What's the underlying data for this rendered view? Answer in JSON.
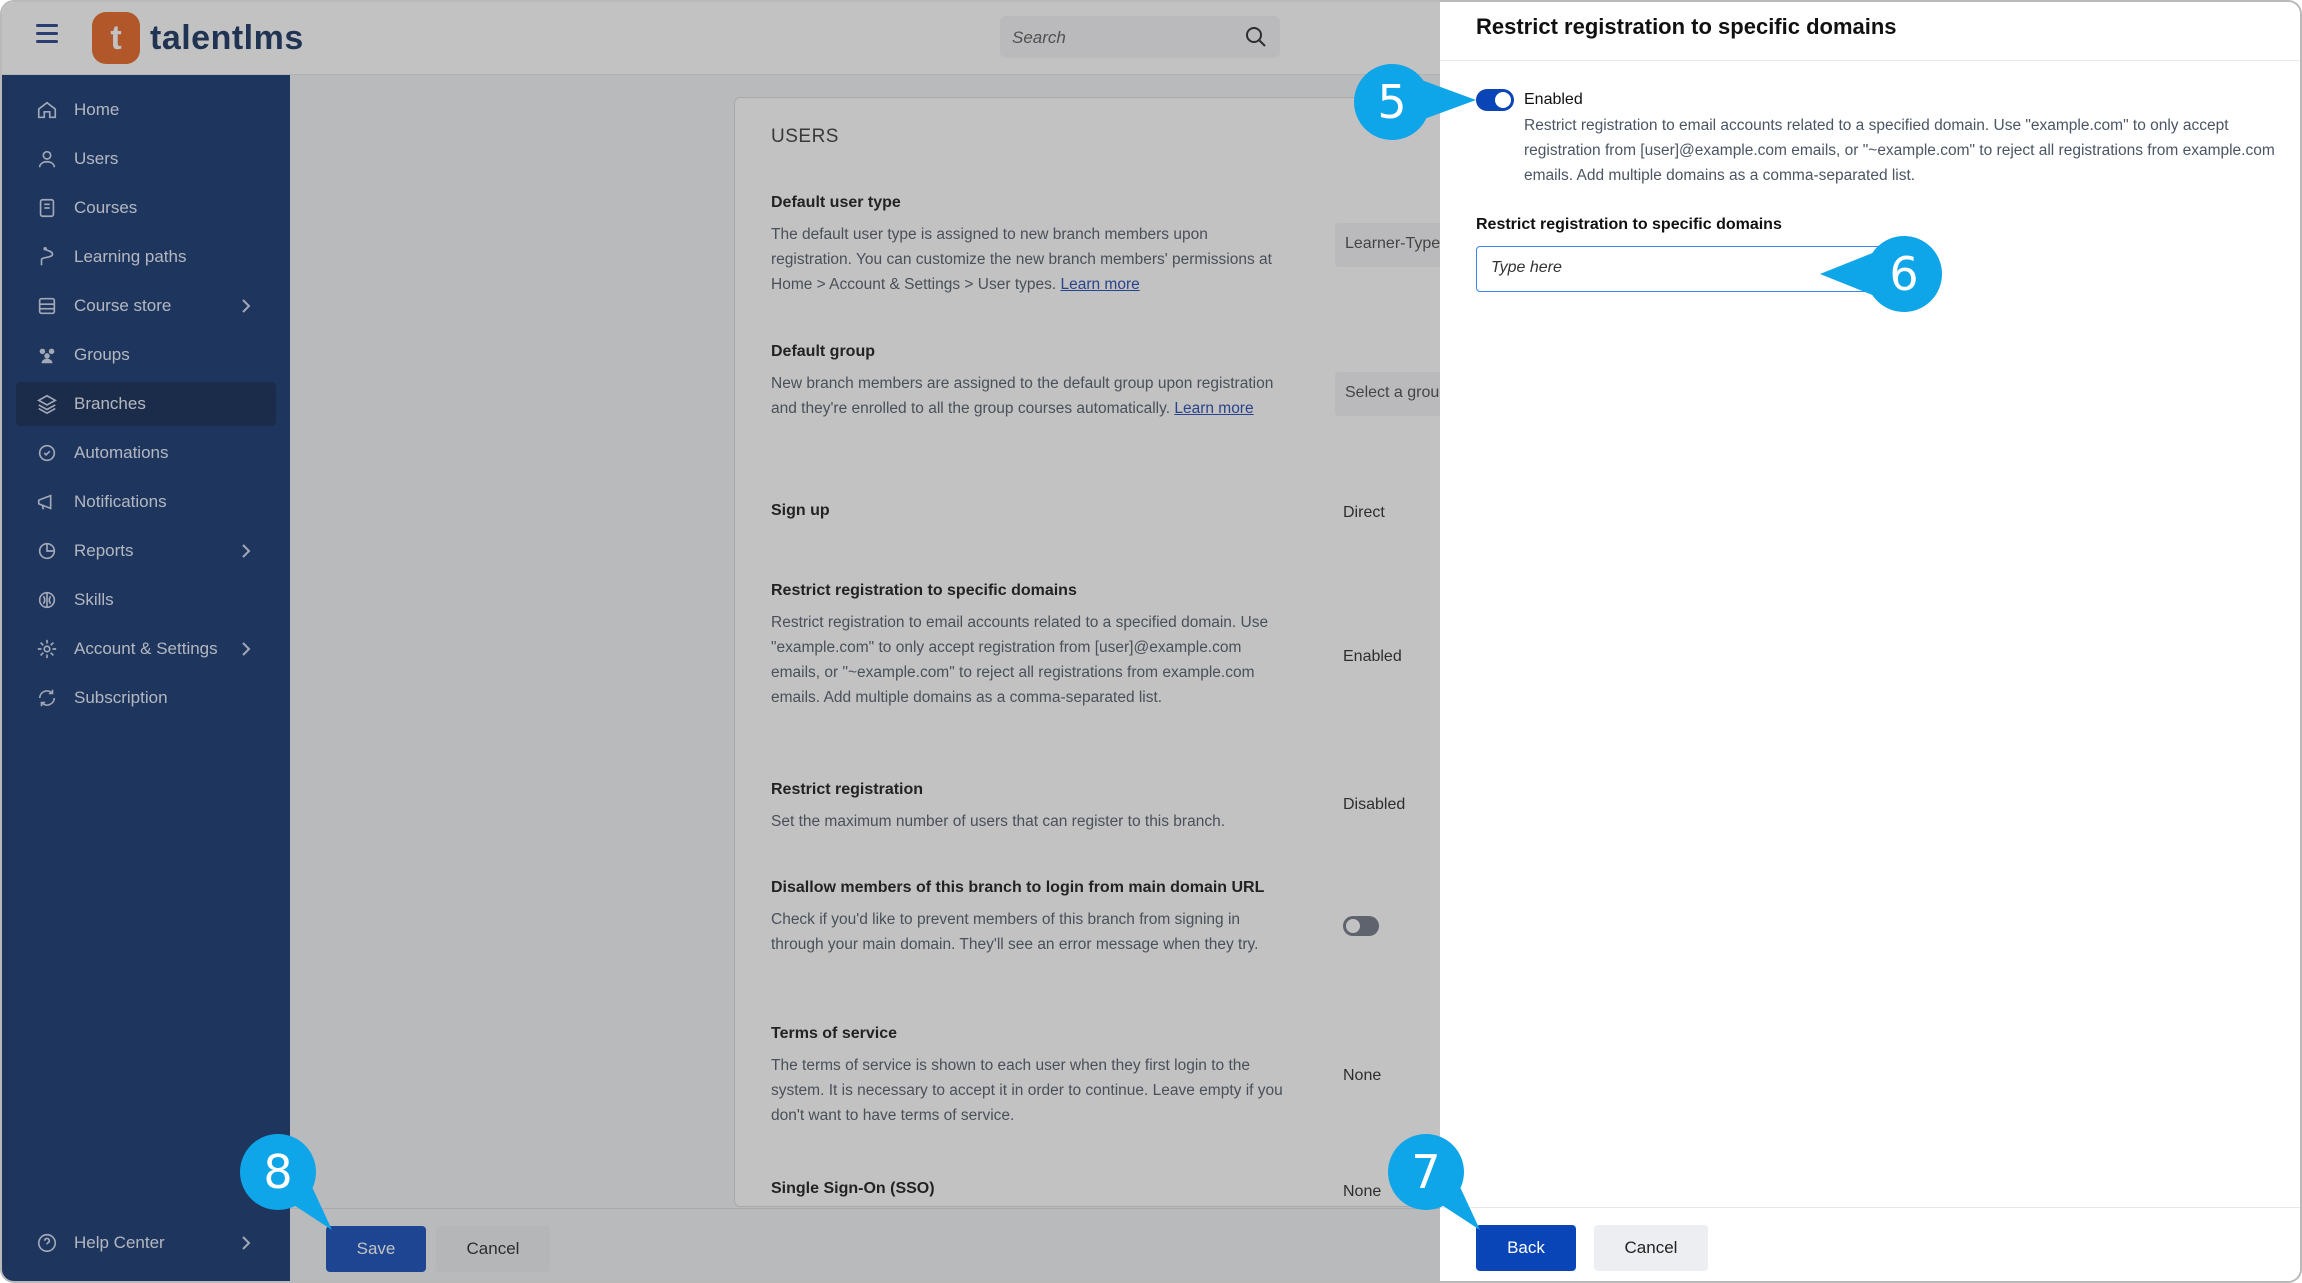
{
  "app": {
    "logo_letter": "t",
    "logo_text": "talentlms"
  },
  "search": {
    "placeholder": "Search"
  },
  "sidebar": {
    "items": [
      {
        "label": "Home"
      },
      {
        "label": "Users"
      },
      {
        "label": "Courses"
      },
      {
        "label": "Learning paths"
      },
      {
        "label": "Course store"
      },
      {
        "label": "Groups"
      },
      {
        "label": "Branches"
      },
      {
        "label": "Automations"
      },
      {
        "label": "Notifications"
      },
      {
        "label": "Reports"
      },
      {
        "label": "Skills"
      },
      {
        "label": "Account & Settings"
      },
      {
        "label": "Subscription"
      }
    ],
    "active": "Branches",
    "help": "Help Center"
  },
  "main": {
    "section_title": "USERS",
    "settings": [
      {
        "title": "Default user type",
        "desc": "The default user type is assigned to new branch members upon registration. You can customize the new branch members' permissions at Home > Account & Settings > User types.",
        "link": "Learn more",
        "value": "Learner-Type"
      },
      {
        "title": "Default group",
        "desc": "New branch members are assigned to the default group upon registration and they're enrolled to all the group courses automatically.",
        "link": "Learn more",
        "value": "Select a group"
      },
      {
        "title": "Sign up",
        "value": "Direct"
      },
      {
        "title": "Restrict registration to specific domains",
        "desc": "Restrict registration to email accounts related to a specified domain. Use \"example.com\" to only accept registration from [user]@example.com emails, or \"~example.com\" to reject all registrations from example.com emails. Add multiple domains as a comma-separated list.",
        "value": "Enabled"
      },
      {
        "title": "Restrict registration",
        "desc": "Set the maximum number of users that can register to this branch.",
        "value": "Disabled"
      },
      {
        "title": "Disallow members of this branch to login from main domain URL",
        "desc": "Check if you'd like to prevent members of this branch from signing in through your main domain. They'll see an error message when they try."
      },
      {
        "title": "Terms of service",
        "desc": "The terms of service is shown to each user when they first login to the system. It is necessary to accept it in order to continue. Leave empty if you don't want to have terms of service.",
        "value": "None"
      },
      {
        "title": "Single Sign-On (SSO)",
        "value": "None"
      }
    ],
    "save_label": "Save",
    "cancel_label": "Cancel"
  },
  "drawer": {
    "title": "Restrict registration to specific domains",
    "toggle_label": "Enabled",
    "desc": "Restrict registration to email accounts related to a specified domain. Use \"example.com\" to only accept registration from [user]@example.com emails, or \"~example.com\" to reject all registrations from example.com emails. Add multiple domains as a comma-separated list.",
    "field_label": "Restrict registration to specific domains",
    "field_placeholder": "Type here",
    "back_label": "Back",
    "cancel_label": "Cancel"
  },
  "callouts": [
    "5",
    "6",
    "7",
    "8"
  ],
  "colors": {
    "sidebar": "#0b2d6b",
    "primary": "#0a45b7",
    "callout": "#0ea5e9",
    "brand": "#e8601c"
  }
}
